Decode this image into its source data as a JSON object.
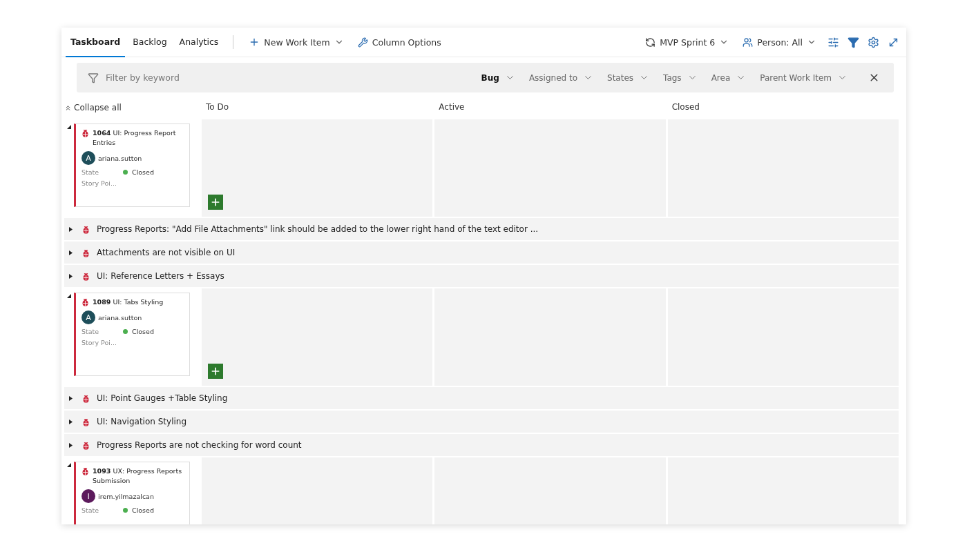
{
  "tabs": [
    {
      "label": "Taskboard",
      "selected": true
    },
    {
      "label": "Backlog",
      "selected": false
    },
    {
      "label": "Analytics",
      "selected": false
    }
  ],
  "actions": {
    "new_item": "New Work Item",
    "column_options": "Column Options"
  },
  "sprint": "MVP Sprint 6",
  "person": "Person: All",
  "filter": {
    "placeholder": "Filter by keyword",
    "chips": [
      {
        "label": "Bug",
        "active": true
      },
      {
        "label": "Assigned to",
        "active": false
      },
      {
        "label": "States",
        "active": false
      },
      {
        "label": "Tags",
        "active": false
      },
      {
        "label": "Area",
        "active": false
      },
      {
        "label": "Parent Work Item",
        "active": false
      }
    ]
  },
  "collapse_all": "Collapse all",
  "columns": [
    "To Do",
    "Active",
    "Closed"
  ],
  "rows": [
    {
      "kind": "expanded",
      "card": {
        "id": "1064",
        "title": "UI: Progress Report Entries",
        "assignee": "ariana.sutton",
        "initial": "A",
        "color": "#1e4e5a",
        "state_label": "State",
        "state": "Closed",
        "story_label": "Story Poi..."
      }
    },
    {
      "kind": "collapsed",
      "title": "Progress Reports: \"Add File Attachments\" link should be added to the lower right hand of the text editor ..."
    },
    {
      "kind": "collapsed",
      "title": "Attachments are not visible on UI"
    },
    {
      "kind": "collapsed",
      "title": "UI: Reference Letters + Essays"
    },
    {
      "kind": "expanded",
      "card": {
        "id": "1089",
        "title": "UI: Tabs Styling",
        "assignee": "ariana.sutton",
        "initial": "A",
        "color": "#1e4e5a",
        "state_label": "State",
        "state": "Closed",
        "story_label": "Story Poi..."
      }
    },
    {
      "kind": "collapsed",
      "title": "UI: Point Gauges +Table Styling"
    },
    {
      "kind": "collapsed",
      "title": "UI: Navigation Styling"
    },
    {
      "kind": "collapsed",
      "title": "Progress Reports are not checking for word count"
    },
    {
      "kind": "expanded",
      "card": {
        "id": "1093",
        "title": "UX: Progress Reports Submission",
        "assignee": "irem.yilmazalcan",
        "initial": "I",
        "color": "#5c1a5c",
        "state_label": "State",
        "state": "Closed"
      }
    }
  ]
}
